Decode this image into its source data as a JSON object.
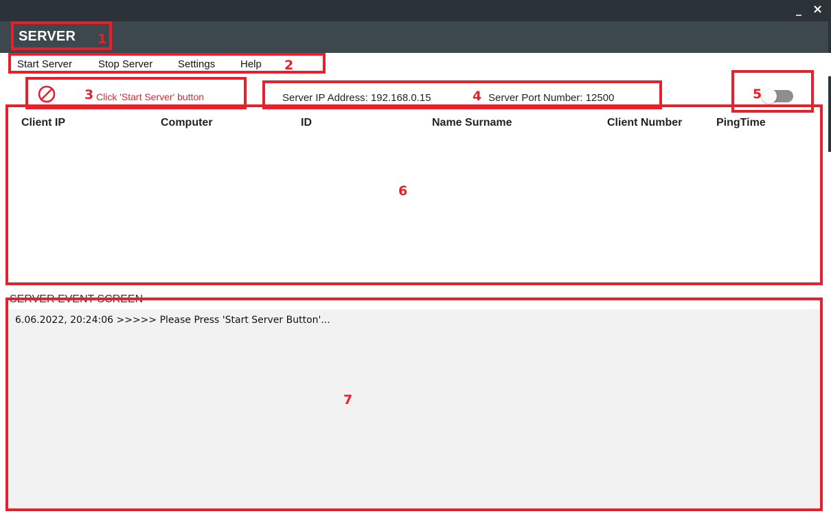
{
  "window": {
    "minimize_glyph": "_",
    "close_glyph": "×"
  },
  "header": {
    "title": "SERVER"
  },
  "menu": {
    "items": [
      "Start Server",
      "Stop Server",
      "Settings",
      "Help"
    ]
  },
  "status": {
    "icon": "no-entry-icon",
    "message": "Click 'Start Server'  button"
  },
  "server_info": {
    "ip_label": "Server IP Address: 192.168.0.15",
    "port_label": "Server Port Number: 12500"
  },
  "toggle": {
    "state": "off"
  },
  "clients_table": {
    "columns": [
      "Client IP",
      "Computer",
      "ID",
      "Name Surname",
      "Client Number",
      "PingTime"
    ],
    "rows": []
  },
  "events": {
    "title": "SERVER EVENT SCREEN",
    "lines": [
      "6.06.2022, 20:24:06 >>>>> Please Press 'Start Server Button'..."
    ]
  },
  "annotations": {
    "labels": [
      "1",
      "2",
      "3",
      "4",
      "5",
      "6",
      "7"
    ],
    "color": "#e8202b"
  },
  "colors": {
    "titlebar": "#2b3339",
    "header": "#3d474e",
    "accent_red": "#e8202b",
    "toggle_track": "#8e8e8e"
  }
}
